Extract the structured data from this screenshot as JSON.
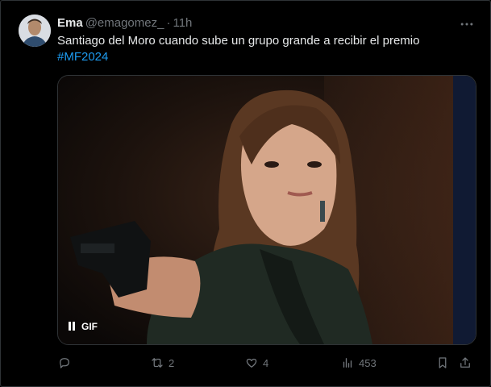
{
  "tweet": {
    "author_name": "Ema",
    "author_handle": "@emagomez_",
    "separator": "·",
    "time": "11h",
    "text": "Santiago del Moro cuando sube un grupo grande a recibir el premio",
    "hashtag": "#MF2024",
    "more_icon": "more-horizontal-icon"
  },
  "media": {
    "badge_label": "GIF",
    "pause_icon": "pause-icon"
  },
  "actions": {
    "reply": {
      "icon": "reply-icon",
      "count": ""
    },
    "retweet": {
      "icon": "retweet-icon",
      "count": "2"
    },
    "like": {
      "icon": "heart-icon",
      "count": "4"
    },
    "views": {
      "icon": "views-icon",
      "count": "453"
    },
    "bookmark": {
      "icon": "bookmark-icon"
    },
    "share": {
      "icon": "share-icon"
    }
  },
  "colors": {
    "background": "#000000",
    "text": "#e7e9ea",
    "muted": "#71767b",
    "link": "#1d9bf0",
    "border": "#2f3336"
  }
}
